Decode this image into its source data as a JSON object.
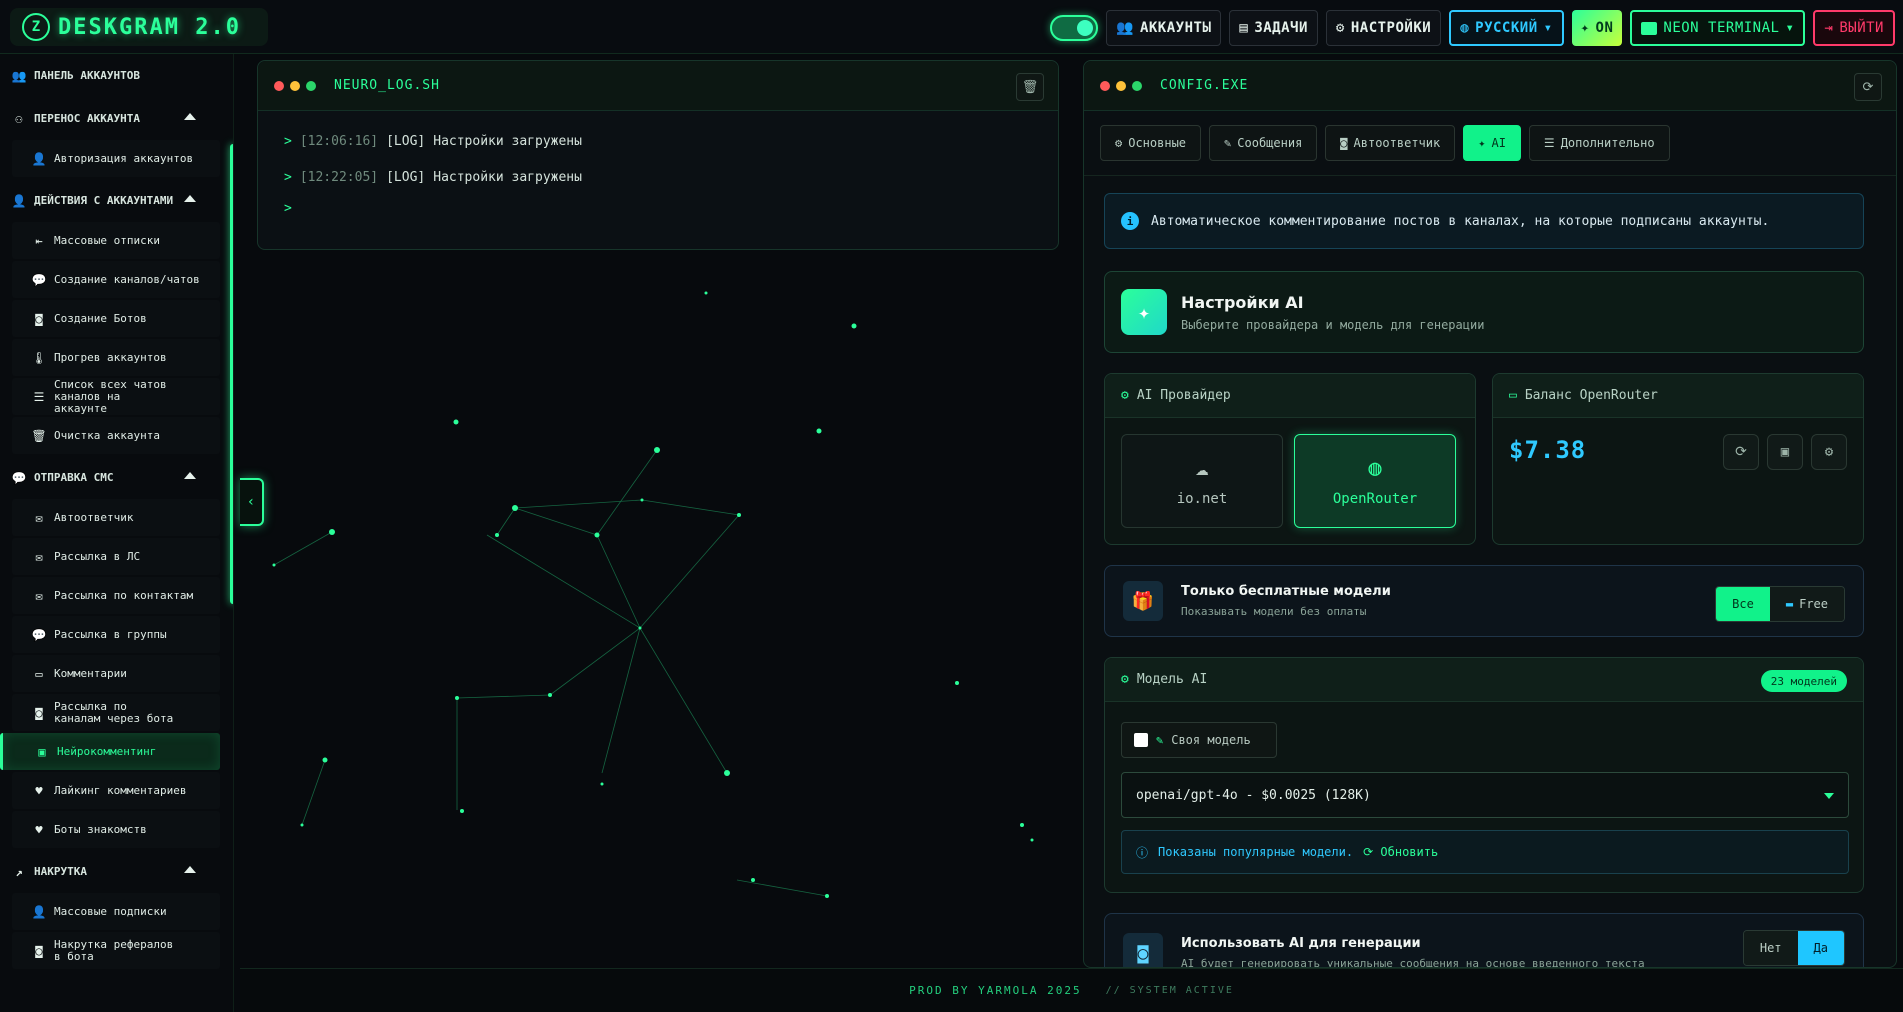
{
  "app": {
    "logo_text": "DESKGRAM 2.0"
  },
  "topbar": {
    "accounts_label": "АККАУНТЫ",
    "tasks_label": "ЗАДАЧИ",
    "settings_label": "НАСТРОЙКИ",
    "language_label": "РУССКИЙ",
    "on_label": "ON",
    "theme_label": "NEON TERMINAL",
    "exit_label": "ВЫЙТИ",
    "toggle_on": true
  },
  "sidebar": {
    "panel_label": "ПАНЕЛЬ АККАУНТОВ",
    "sections": [
      {
        "label": "ПЕРЕНОС АККАУНТА",
        "items": [
          "Авторизация аккаунтов"
        ]
      },
      {
        "label": "ДЕЙСТВИЯ С АККАУНТАМИ",
        "items": [
          "Массовые отписки",
          "Создание каналов/чатов",
          "Создание Ботов",
          "Прогрев аккаунтов",
          "Список всех чатов каналов на аккаунте",
          "Очистка аккаунта"
        ]
      },
      {
        "label": "ОТПРАВКА СМС",
        "items": [
          "Автоответчик",
          "Рассылка в ЛС",
          "Рассылка по контактам",
          "Рассылка в группы",
          "Комментарии",
          "Рассылка по каналам через бота",
          "Нейрокомментинг",
          "Лайкинг комментариев",
          "Боты знакомств"
        ]
      },
      {
        "label": "НАКРУТКА",
        "items": [
          "Массовые подписки",
          "Накрутка рефералов в бота"
        ]
      }
    ],
    "active_item": "Нейрокомментинг"
  },
  "log": {
    "title": "NEURO_LOG.SH",
    "lines": [
      {
        "time": "[12:06:16]",
        "tag": "[LOG]",
        "msg": "Настройки загружены"
      },
      {
        "time": "[12:22:05]",
        "tag": "[LOG]",
        "msg": "Настройки загружены"
      }
    ],
    "prompt": ">"
  },
  "config": {
    "title": "CONFIG.EXE",
    "tabs": [
      "Основные",
      "Сообщения",
      "Автоответчик",
      "AI",
      "Дополнительно"
    ],
    "active_tab": "AI",
    "info_text": "Автоматическое комментирование постов в каналах, на которые подписаны аккаунты.",
    "ai_header": {
      "title": "Настройки AI",
      "subtitle": "Выберите провайдера и модель для генерации"
    },
    "provider": {
      "title": "AI Провайдер",
      "options": [
        "io.net",
        "OpenRouter"
      ],
      "selected": "OpenRouter"
    },
    "balance": {
      "title": "Баланс OpenRouter",
      "value": "$7.38"
    },
    "free_models": {
      "title": "Только бесплатные модели",
      "subtitle": "Показывать модели без оплаты",
      "opt_all": "Все",
      "opt_free": "Free",
      "selected": "Все"
    },
    "model": {
      "title": "Модель AI",
      "count_badge": "23 моделей",
      "custom_label": "Своя модель",
      "selected_value": "openai/gpt-4o - $0.0025 (128K)",
      "note": "Показаны популярные модели.",
      "refresh_label": "Обновить"
    },
    "use_ai": {
      "title": "Использовать AI для генерации",
      "subtitle": "AI будет генерировать уникальные сообщения на основе введенного текста",
      "opt_no": "Нет",
      "opt_yes": "Да",
      "selected": "Да"
    }
  },
  "footer": {
    "credit": "PROD BY YARMOLA 2025",
    "status": "// SYSTEM ACTIVE"
  },
  "colors": {
    "accent": "#2bff9a",
    "info": "#2fc9ff",
    "danger": "#ff3a6a",
    "bg": "#070a0d"
  }
}
